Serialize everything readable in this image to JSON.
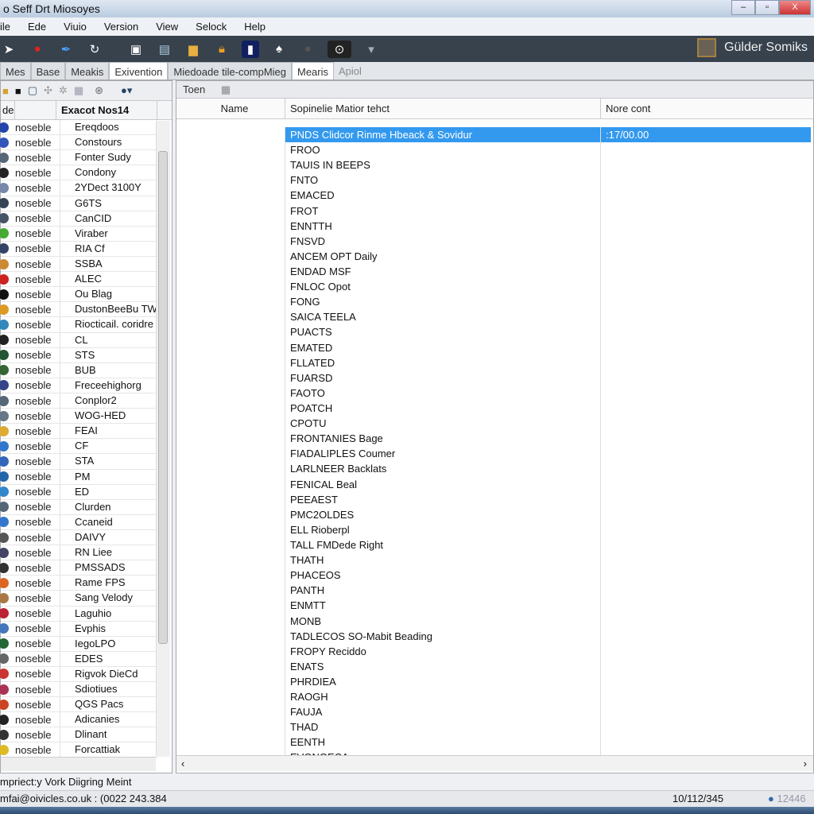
{
  "window": {
    "title": "o Seff Drt Miosoyes",
    "minimize": "–",
    "maximize": "▫",
    "close": "X"
  },
  "menu": [
    "ile",
    "Ede",
    "Viuio",
    "Version",
    "View",
    "Selock",
    "Help"
  ],
  "toolbar": {
    "brand": "Gülder Somiks",
    "icons": [
      "pin-icon",
      "user-icon",
      "feather-icon",
      "refresh-icon",
      "image-icon",
      "document-icon",
      "folder-icon",
      "lock-icon",
      "chart-icon",
      "tree-icon",
      "record-icon",
      "eye-icon",
      "dropdown-icon"
    ]
  },
  "tabs": [
    "Mes",
    "Base",
    "Meakis",
    "Exivention",
    "Miedoade tile-compMieg",
    "Mearis",
    "Apiol"
  ],
  "left": {
    "columns": [
      "de",
      "",
      "Exacot Nos14"
    ],
    "prefix": "noseble",
    "scroll_label": "",
    "items": [
      "Ereqdoos",
      "Constours",
      "Fonter Sudy",
      "Condony",
      "2YDect 3100Y",
      "G6TS",
      "CanCID",
      "Viraber",
      "RIA Cf",
      "SSBA",
      "ALEC",
      "Ou Blag",
      "DustonBeeBu TW",
      "Riocticail. coridre",
      "CL",
      "STS",
      "BUB",
      "Freceehighorg",
      "Conplor2",
      "WOG-HED",
      "FEAI",
      "CF",
      "STA",
      "PM",
      "ED",
      "Clurden",
      "Ccaneid",
      "DAIVY",
      "RN Liee",
      "PMSSADS",
      "Rame FPS",
      "Sang Velody",
      "Laguhio",
      "Evphis",
      "IegoLPO",
      "EDES",
      "Rigvok DieCd",
      "Sdiotiues",
      "QGS Pacs",
      "Adicanies",
      "Dlinant",
      "Forcattiak"
    ],
    "icon_colors": [
      "#2244aa",
      "#3355bb",
      "#556677",
      "#222222",
      "#7788aa",
      "#334455",
      "#445566",
      "#44aa33",
      "#334466",
      "#cc8833",
      "#cc2222",
      "#111111",
      "#dd9922",
      "#3388bb",
      "#222222",
      "#225533",
      "#336633",
      "#334488",
      "#556677",
      "#667788",
      "#ddaa33",
      "#3377cc",
      "#3366bb",
      "#2266aa",
      "#3388cc",
      "#556677",
      "#3377cc",
      "#555555",
      "#444466",
      "#333333",
      "#dd6622",
      "#aa7744",
      "#bb2233",
      "#4477bb",
      "#226633",
      "#666666",
      "#cc3333",
      "#aa3355",
      "#cc4422",
      "#222222",
      "#333333",
      "#ddbb22"
    ]
  },
  "right": {
    "subtoolbar": "Toen",
    "columns": [
      "Name",
      "Sopinelie Matior tehct",
      "Nore cont"
    ],
    "rows": [
      [
        "PNDS Clidcor Rinme Hbeack & Sovidur",
        ":17/00.00"
      ],
      [
        "FROO",
        ""
      ],
      [
        "TAUIS IN BEEPS",
        ""
      ],
      [
        "FNTO",
        ""
      ],
      [
        "EMACED",
        ""
      ],
      [
        "FROT",
        ""
      ],
      [
        "ENNTTH",
        ""
      ],
      [
        "FNSVD",
        ""
      ],
      [
        "ANCEM OPT Daily",
        ""
      ],
      [
        "ENDAD MSF",
        ""
      ],
      [
        "FNLOC Opot",
        ""
      ],
      [
        "FONG",
        ""
      ],
      [
        "SAICA TEELA",
        ""
      ],
      [
        "PUACTS",
        ""
      ],
      [
        "EMATED",
        ""
      ],
      [
        "FLLATED",
        ""
      ],
      [
        "FUARSD",
        ""
      ],
      [
        "FAOTO",
        ""
      ],
      [
        "POATCH",
        ""
      ],
      [
        "CPOTU",
        ""
      ],
      [
        "FRONTANIES Bage",
        ""
      ],
      [
        "FIADALIPLES Coumer",
        ""
      ],
      [
        "LARLNEER Backlats",
        ""
      ],
      [
        "FENICAL Beal",
        ""
      ],
      [
        "PEEAEST",
        ""
      ],
      [
        "PMC2OLDES",
        ""
      ],
      [
        "ELL Rioberpl",
        ""
      ],
      [
        "TALL FMDede Right",
        ""
      ],
      [
        "THATH",
        ""
      ],
      [
        "PHACEOS",
        ""
      ],
      [
        "PANTH",
        ""
      ],
      [
        "ENMTT",
        ""
      ],
      [
        "MONB",
        ""
      ],
      [
        "TADLECOS SO-Mabit Beading",
        ""
      ],
      [
        "FROPY Reciddo",
        ""
      ],
      [
        "ENATS",
        ""
      ],
      [
        "PHRDIEA",
        ""
      ],
      [
        "RAOGH",
        ""
      ],
      [
        "FAUJA",
        ""
      ],
      [
        "THAD",
        ""
      ],
      [
        "EENTH",
        ""
      ],
      [
        "EVONGECA",
        ""
      ]
    ]
  },
  "status": {
    "line1": "mpriect:y Vork Diigring Meint",
    "contact": "mfai@oivicles.co.uk : (0022 243.384",
    "code": "10/112/345",
    "indicator": "12446"
  },
  "colors": {
    "toolbar_bg": "#37424d",
    "selection": "#3399ee"
  }
}
